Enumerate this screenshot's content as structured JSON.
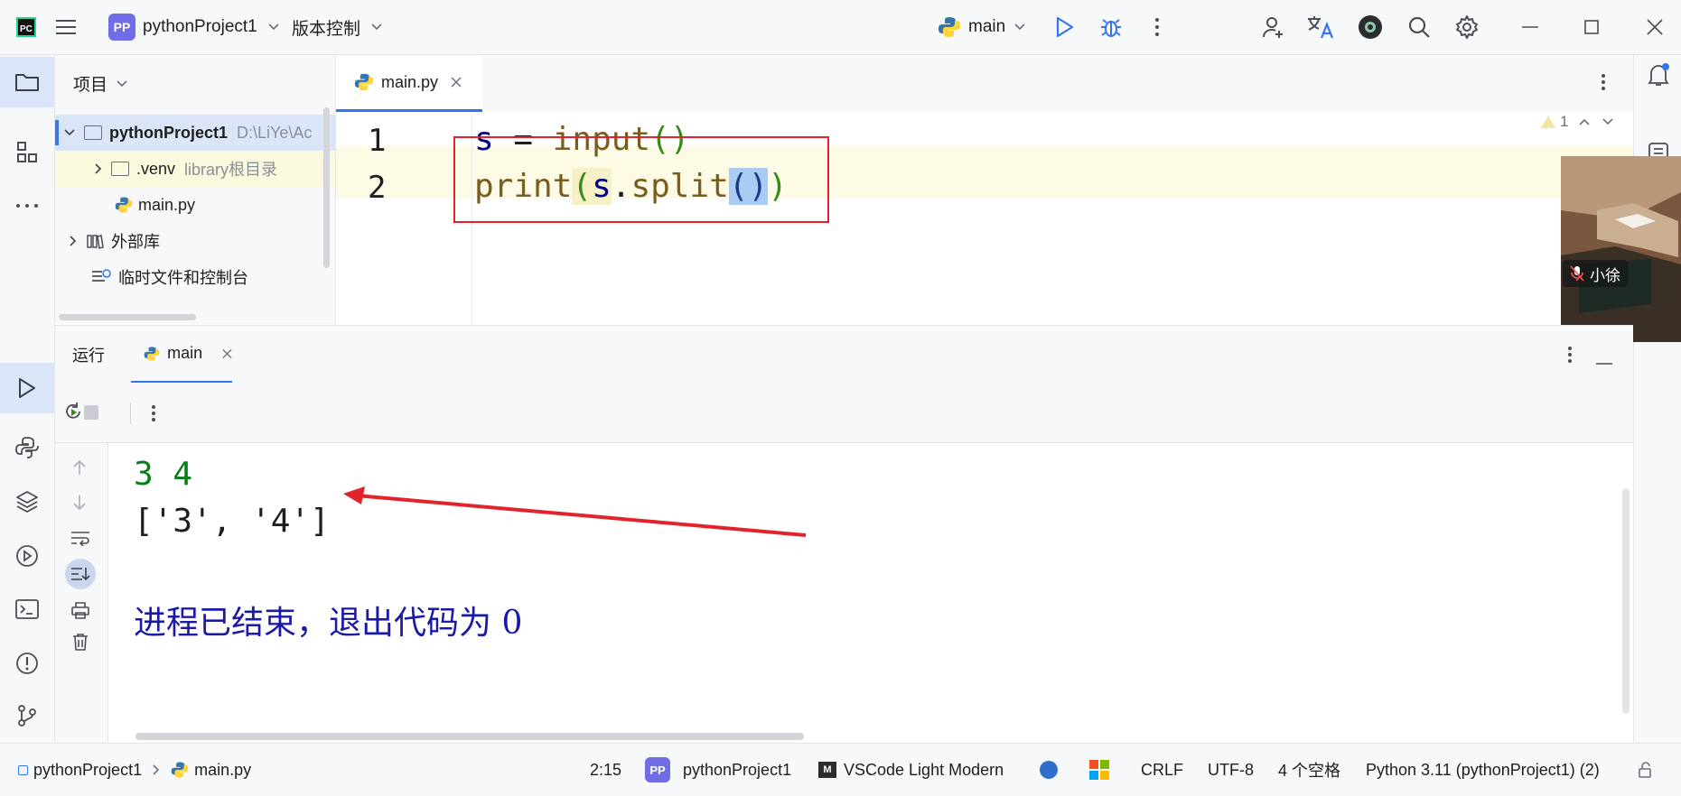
{
  "titlebar": {
    "project_badge": "PP",
    "project_name": "pythonProject1",
    "vcs_label": "版本控制",
    "run_config": "main"
  },
  "sidebar": {
    "title": "项目",
    "tree": [
      {
        "label": "pythonProject1",
        "hint": "D:\\LiYe\\Ac"
      },
      {
        "label": ".venv",
        "hint": "library根目录"
      },
      {
        "label": "main.py"
      },
      {
        "label": "外部库"
      },
      {
        "label": "临时文件和控制台"
      }
    ]
  },
  "editor": {
    "tab_label": "main.py",
    "inspection_count": "1",
    "line_numbers": [
      "1",
      "2"
    ],
    "code": {
      "line1": {
        "var": "s",
        "op": " = ",
        "fn": "input",
        "parens": "()"
      },
      "line2": {
        "fn": "print",
        "open": "(",
        "var": "s",
        "dot": ".",
        "method": "split",
        "call": "()",
        "close": ")"
      }
    }
  },
  "run": {
    "title": "运行",
    "tab_label": "main",
    "console": {
      "input_line": "3 4",
      "output_line": "['3', '4']",
      "exit_message": "进程已结束，退出代码为 0"
    }
  },
  "video": {
    "name": "小徐"
  },
  "statusbar": {
    "breadcrumb_project": "pythonProject1",
    "breadcrumb_file": "main.py",
    "position": "2:15",
    "project_badge": "PP",
    "project_name": "pythonProject1",
    "theme": "VSCode Light Modern",
    "line_ending": "CRLF",
    "encoding": "UTF-8",
    "indent": "4 个空格",
    "interpreter": "Python 3.11 (pythonProject1) (2)"
  },
  "colors": {
    "accent": "#3574f0",
    "keyword_fn": "#7a5c1e",
    "var": "#000080",
    "console_input": "#067d17",
    "console_exit": "#1a1aa6",
    "annotation_red": "#e3232c"
  }
}
